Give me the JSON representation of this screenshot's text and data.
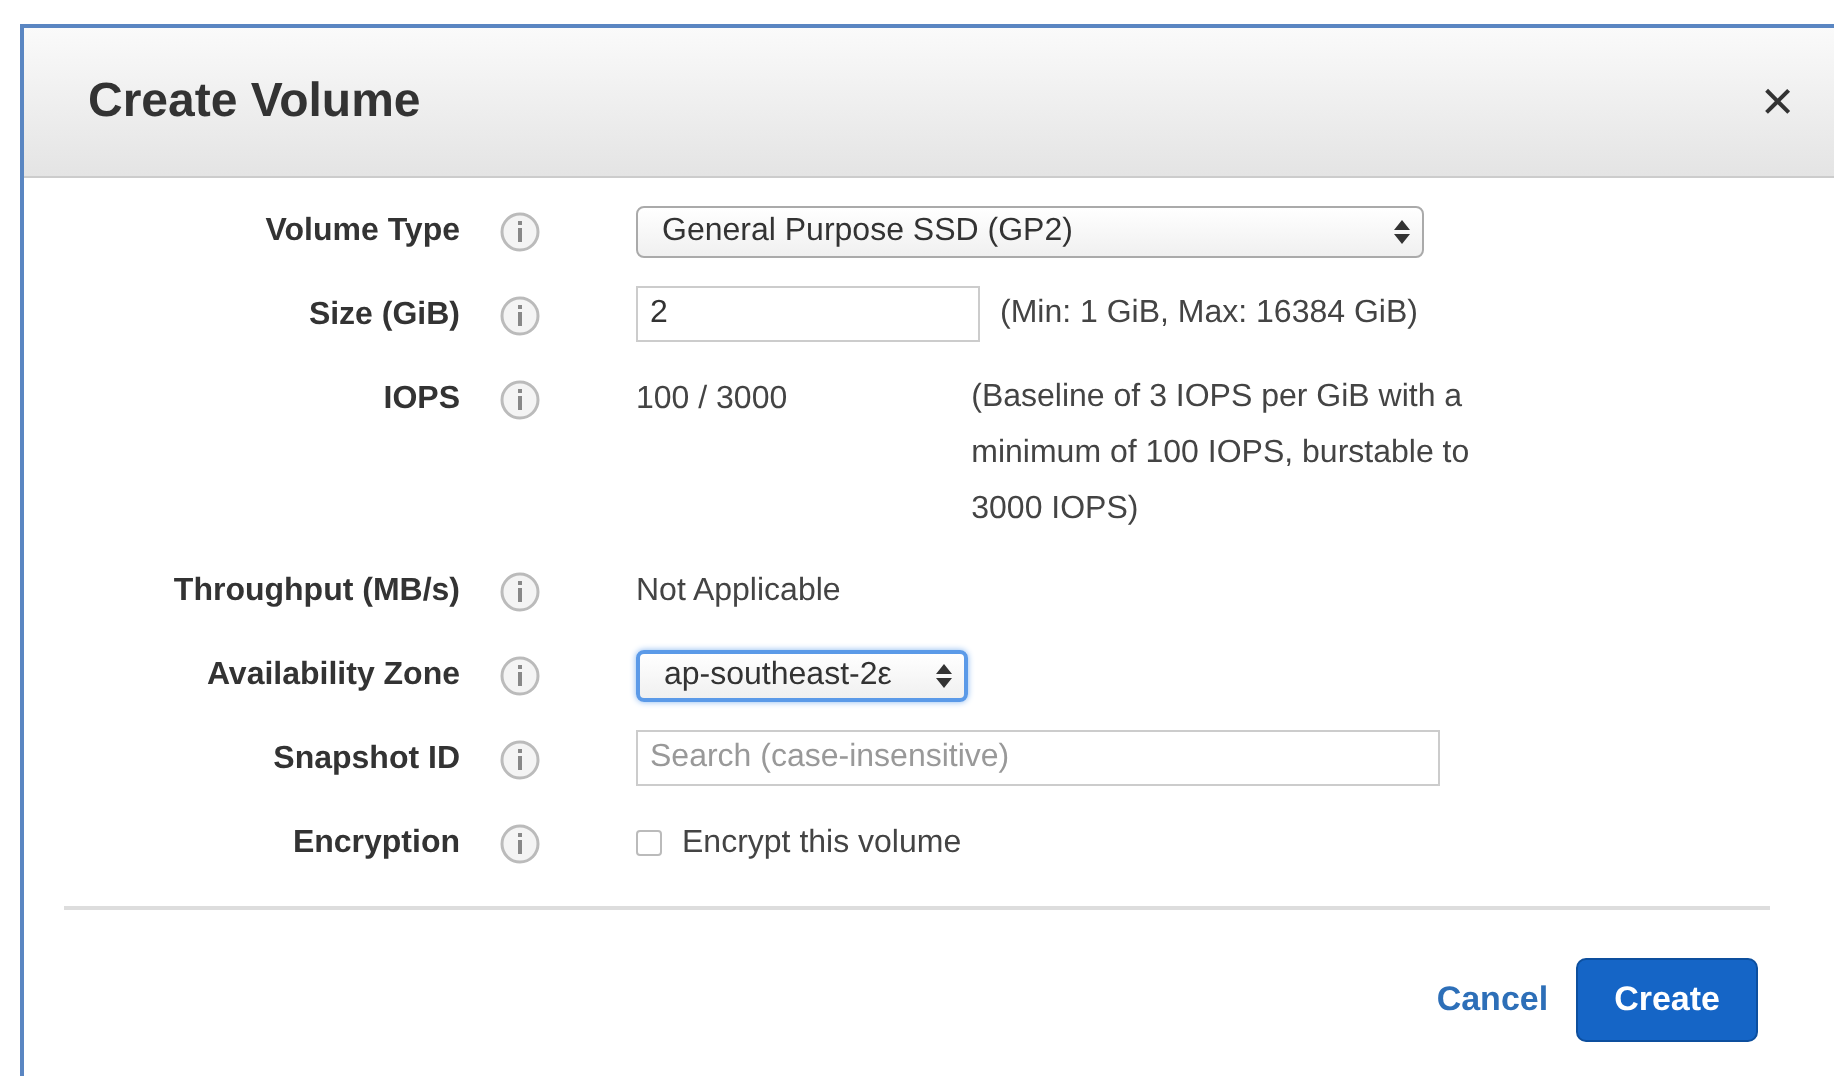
{
  "dialog": {
    "title": "Create Volume",
    "close": "×"
  },
  "fields": [
    {
      "label": "Volume Type",
      "kind": "select",
      "value": "General Purpose SSD (GP2)",
      "focused": false,
      "wide": true
    },
    {
      "label": "Size (GiB)",
      "kind": "input",
      "value": "2",
      "note": "(Min: 1 GiB, Max: 16384 GiB)"
    },
    {
      "label": "IOPS",
      "kind": "text",
      "value": "100 / 3000",
      "note": "(Baseline of 3 IOPS per GiB with a minimum of 100 IOPS, burstable to 3000 IOPS)"
    },
    {
      "label": "Throughput (MB/s)",
      "kind": "text",
      "value": "Not Applicable"
    },
    {
      "label": "Availability Zone",
      "kind": "select",
      "value": "ap-southeast-2ε",
      "focused": true,
      "wide": false
    },
    {
      "label": "Snapshot ID",
      "kind": "search",
      "placeholder": "Search (case-insensitive)"
    },
    {
      "label": "Encryption",
      "kind": "checkbox",
      "text": "Encrypt this volume",
      "checked": false
    }
  ],
  "buttons": {
    "cancel": "Cancel",
    "create": "Create"
  }
}
